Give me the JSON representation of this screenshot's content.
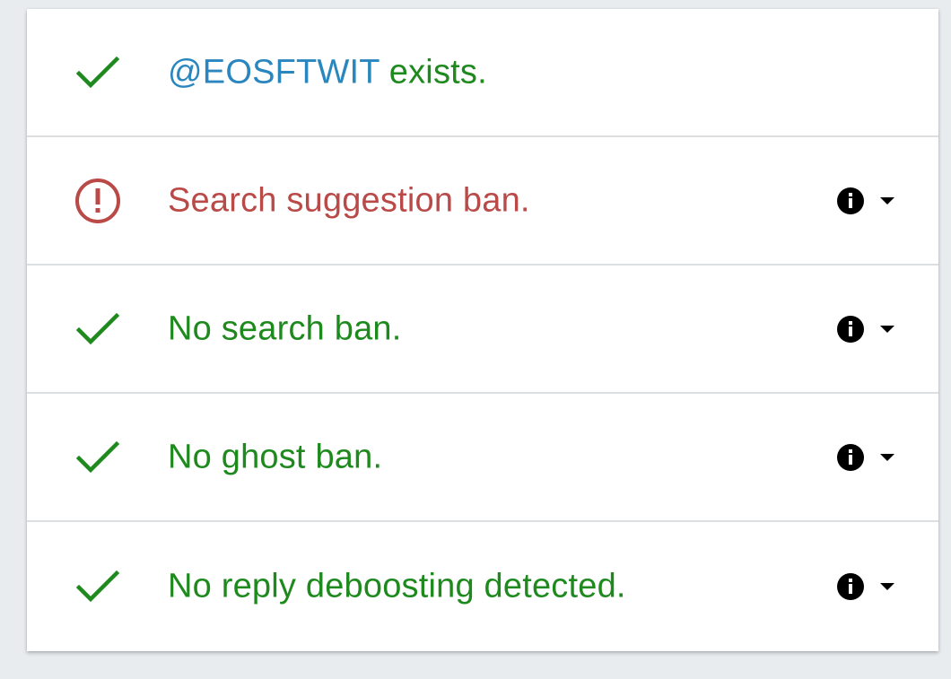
{
  "colors": {
    "ok": "#1e8a1e",
    "bad": "#b94a48",
    "handle": "#2a86bf",
    "icon_dark": "#000000"
  },
  "rows": [
    {
      "status": "ok",
      "status_icon": "check-icon",
      "handle": "@EOSFTWIT",
      "text": "exists.",
      "has_controls": false
    },
    {
      "status": "bad",
      "status_icon": "exclamation-circle-icon",
      "text": "Search suggestion ban.",
      "has_controls": true,
      "controls": [
        "info-icon",
        "caret-down-icon"
      ]
    },
    {
      "status": "ok",
      "status_icon": "check-icon",
      "text": "No search ban.",
      "has_controls": true,
      "controls": [
        "info-icon",
        "caret-down-icon"
      ]
    },
    {
      "status": "ok",
      "status_icon": "check-icon",
      "text": "No ghost ban.",
      "has_controls": true,
      "controls": [
        "info-icon",
        "caret-down-icon"
      ]
    },
    {
      "status": "ok",
      "status_icon": "check-icon",
      "text": "No reply deboosting detected.",
      "has_controls": true,
      "controls": [
        "info-icon",
        "caret-down-icon"
      ]
    }
  ]
}
